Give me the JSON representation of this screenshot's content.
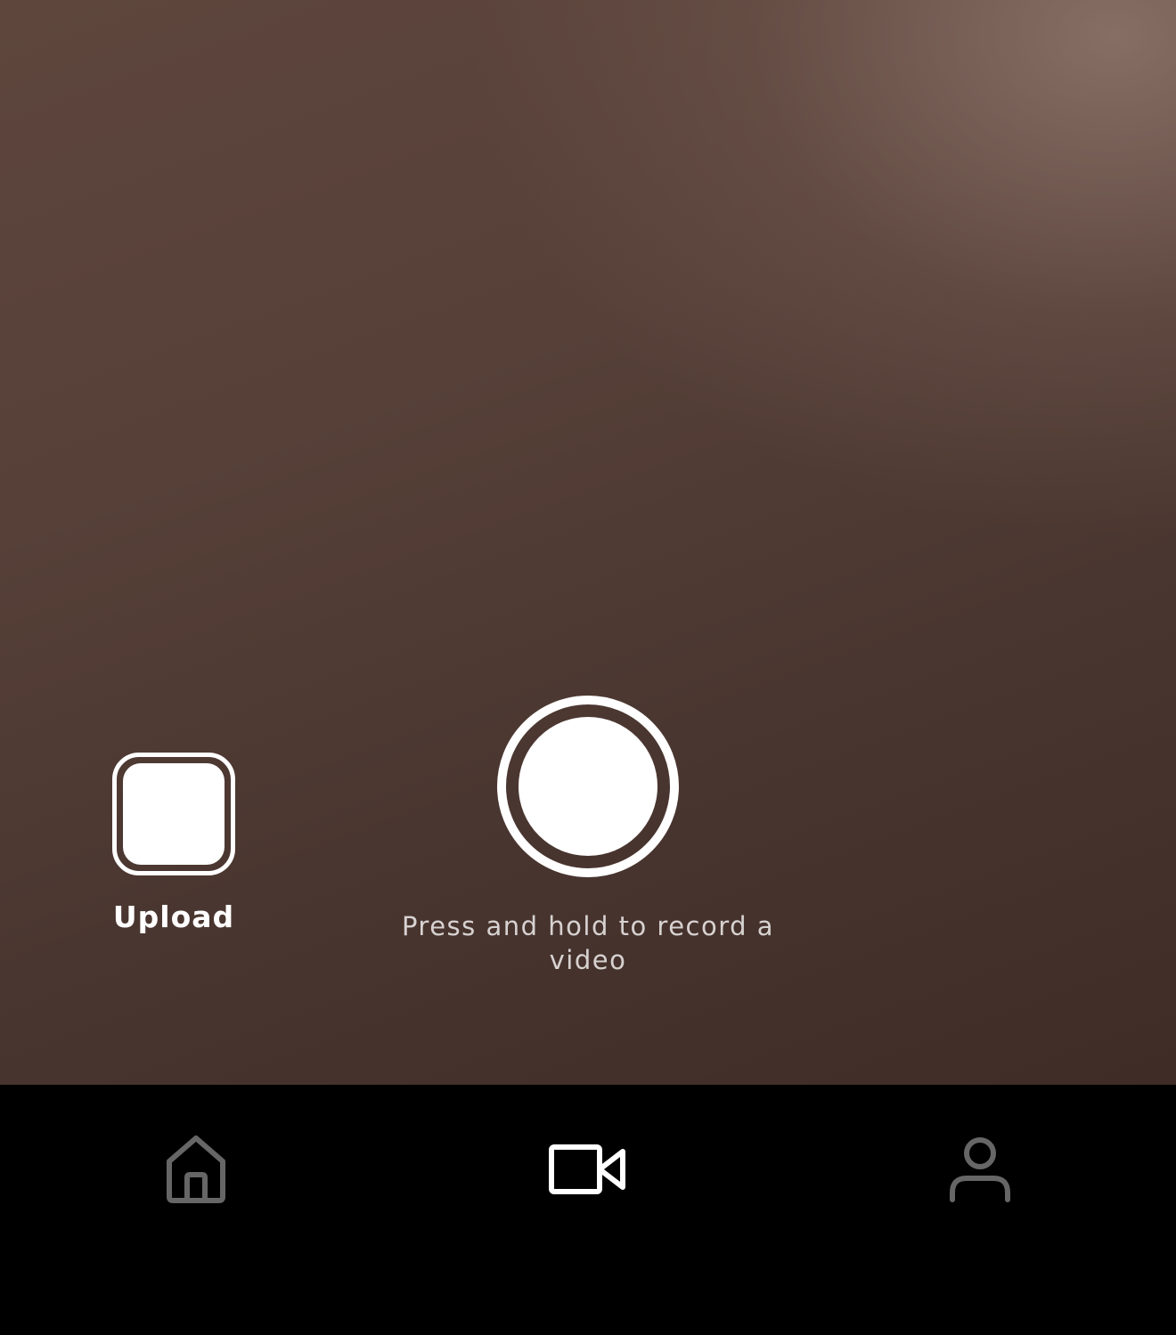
{
  "camera": {
    "upload_label": "Upload",
    "record_hint": "Press and hold to record a video"
  },
  "tab_bar": {
    "tabs": [
      {
        "name": "home",
        "icon": "home-icon",
        "active": false,
        "color": "#666666"
      },
      {
        "name": "record",
        "icon": "video-camera-icon",
        "active": true,
        "color": "#ffffff"
      },
      {
        "name": "profile",
        "icon": "person-icon",
        "active": false,
        "color": "#666666"
      }
    ]
  },
  "colors": {
    "accent": "#ffffff",
    "tab_inactive": "#666666",
    "tab_bar_bg": "#000000"
  }
}
